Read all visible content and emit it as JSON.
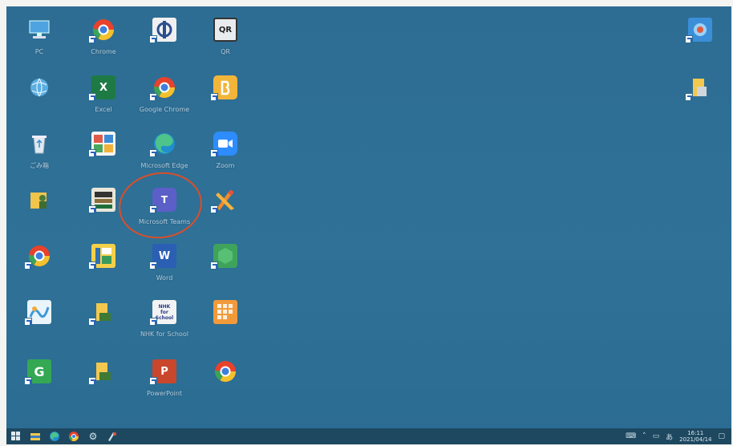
{
  "desktop": {
    "icons": {
      "pc": {
        "label": "PC"
      },
      "chrome_top": {
        "label": "Chrome"
      },
      "app_r1c3": {
        "label": ""
      },
      "qr_app": {
        "label": "QR"
      },
      "network": {
        "label": ""
      },
      "excel": {
        "label": "Excel"
      },
      "google_chrome": {
        "label": "Google Chrome"
      },
      "app_r2c4": {
        "label": ""
      },
      "recycle_bin": {
        "label": "ごみ箱"
      },
      "app_r3c2": {
        "label": ""
      },
      "microsoft_edge": {
        "label": "Microsoft Edge"
      },
      "zoom": {
        "label": "Zoom"
      },
      "user_folder": {
        "label": ""
      },
      "app_r4c2": {
        "label": ""
      },
      "microsoft_teams": {
        "label": "Microsoft Teams"
      },
      "app_r4c4": {
        "label": ""
      },
      "chrome_r5": {
        "label": ""
      },
      "app_r5c2": {
        "label": ""
      },
      "word": {
        "label": "Word"
      },
      "app_r5c4": {
        "label": ""
      },
      "app_r6c1": {
        "label": ""
      },
      "folder_r6c2": {
        "label": ""
      },
      "nhk_for_school": {
        "label": "NHK for School"
      },
      "app_r6c4": {
        "label": ""
      },
      "app_r7c1": {
        "label": ""
      },
      "folder_r7c2": {
        "label": ""
      },
      "powerpoint": {
        "label": "PowerPoint"
      },
      "chrome_r7c4": {
        "label": ""
      },
      "right_top_icon": {
        "label": ""
      },
      "right_folder": {
        "label": ""
      }
    },
    "glyph_text": {
      "qr": "QR",
      "excel": "X",
      "word": "W",
      "powerpoint": "P",
      "teams": "T",
      "g_app": "G",
      "nhk": "NHK for School"
    }
  },
  "annotation": {
    "ring_color": "#d94f2a"
  },
  "taskbar": {
    "ime": "あ",
    "time": "16:11",
    "date": "2021/04/14"
  }
}
